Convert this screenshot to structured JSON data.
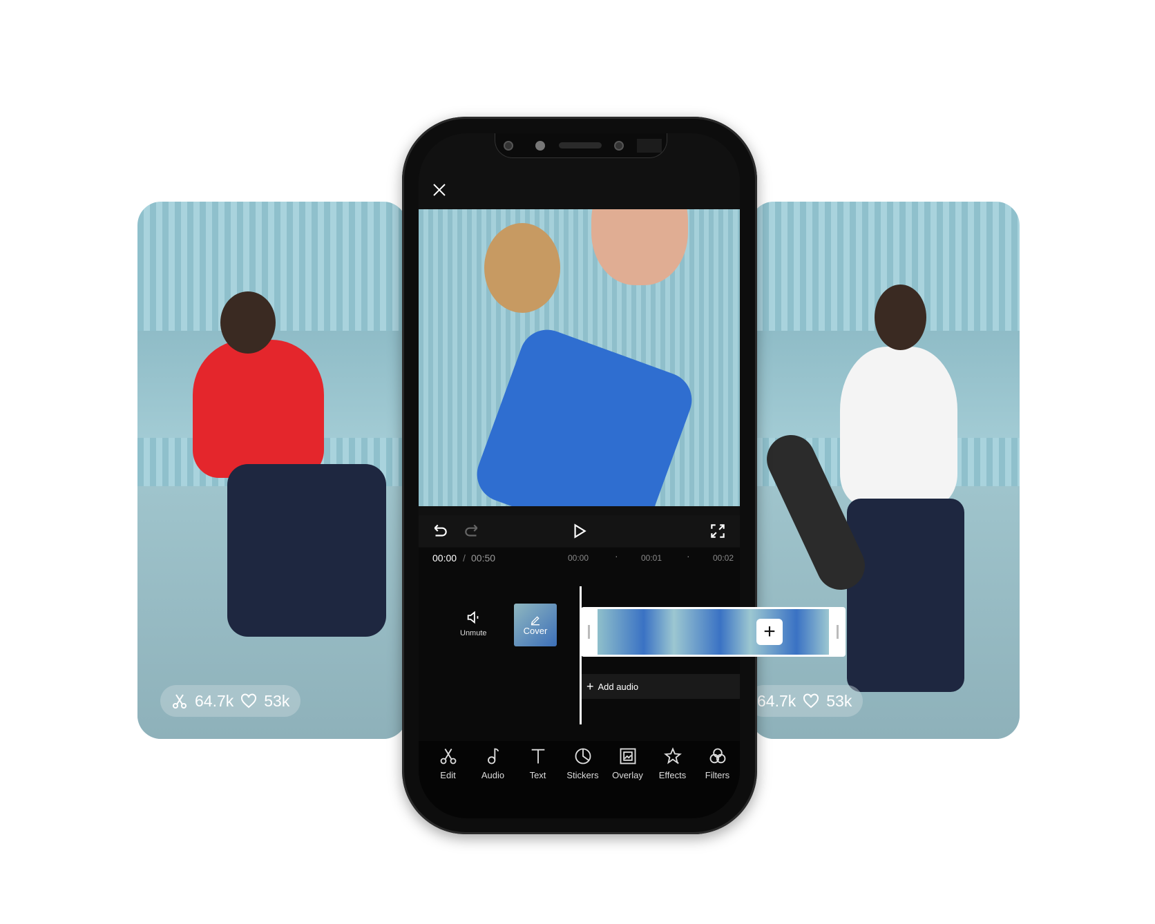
{
  "cards": {
    "left": {
      "cuts": "64.7k",
      "likes": "53k",
      "shirt_color": "#e4262c"
    },
    "right": {
      "cuts": "64.7k",
      "likes": "53k",
      "shirt_color": "#f4f4f4"
    }
  },
  "editor": {
    "time_current": "00:00",
    "time_separator": "/",
    "time_total": "00:50",
    "ruler": [
      "00:00",
      "00:01",
      "00:02"
    ],
    "unmute_label": "Unmute",
    "cover_label": "Cover",
    "add_audio_label": "Add audio",
    "add_clip_symbol": "+",
    "toolbar": [
      {
        "label": "Edit",
        "icon": "scissors-icon"
      },
      {
        "label": "Audio",
        "icon": "music-note-icon"
      },
      {
        "label": "Text",
        "icon": "text-icon"
      },
      {
        "label": "Stickers",
        "icon": "sticker-icon"
      },
      {
        "label": "Overlay",
        "icon": "overlay-icon"
      },
      {
        "label": "Effects",
        "icon": "star-effects-icon"
      },
      {
        "label": "Filters",
        "icon": "filters-icon"
      }
    ]
  }
}
